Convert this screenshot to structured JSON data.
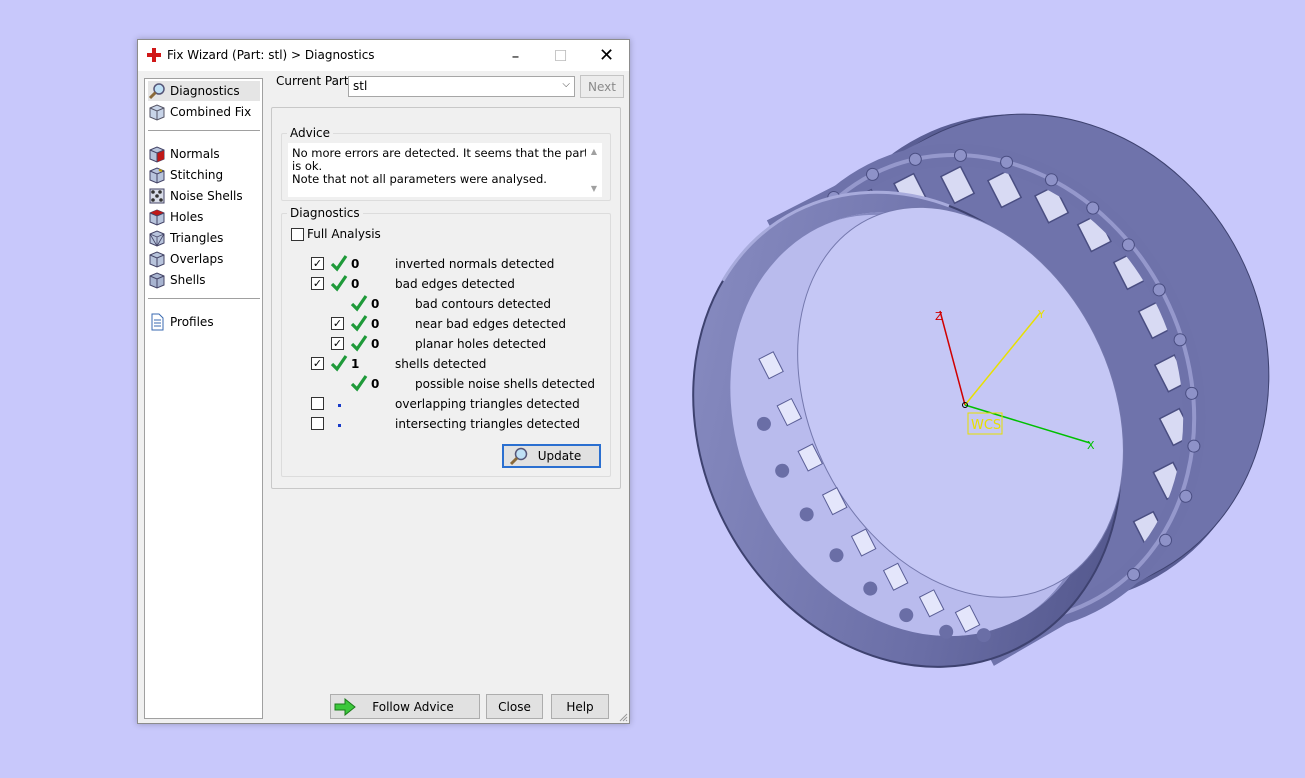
{
  "window": {
    "title": "Fix Wizard (Part: stl) > Diagnostics",
    "minimize": "–",
    "maximize": "☐",
    "close": "✕"
  },
  "sidebar": {
    "items": [
      {
        "label": "Diagnostics",
        "icon": "magnifier-icon",
        "selected": true
      },
      {
        "label": "Combined Fix",
        "icon": "cube-icon"
      },
      {
        "label": "Normals",
        "icon": "normals-cube-icon"
      },
      {
        "label": "Stitching",
        "icon": "stitching-cube-icon"
      },
      {
        "label": "Noise Shells",
        "icon": "noise-shells-icon"
      },
      {
        "label": "Holes",
        "icon": "holes-cube-icon"
      },
      {
        "label": "Triangles",
        "icon": "triangles-cube-icon"
      },
      {
        "label": "Overlaps",
        "icon": "overlaps-cube-icon"
      },
      {
        "label": "Shells",
        "icon": "shells-cube-icon"
      },
      {
        "label": "Profiles",
        "icon": "document-icon"
      }
    ]
  },
  "main": {
    "current_part_label": "Current Part:",
    "current_part_value": "stl",
    "next_label": "Next",
    "advice": {
      "title": "Advice",
      "text_line1": "No more errors are detected. It seems that the part is ok.",
      "text_line2": "Note that not all parameters were analysed."
    },
    "diagnostics": {
      "title": "Diagnostics",
      "full_analysis_label": "Full Analysis",
      "full_analysis_checked": false,
      "rows": [
        {
          "checked": true,
          "status": "ok",
          "count": "0",
          "label": "inverted normals detected"
        },
        {
          "checked": true,
          "status": "ok",
          "count": "0",
          "label": "bad edges detected"
        },
        {
          "checkbox": false,
          "status": "ok",
          "count": "0",
          "label": "bad contours detected"
        },
        {
          "checked": true,
          "status": "ok",
          "count": "0",
          "label": "near bad edges detected"
        },
        {
          "checked": true,
          "status": "ok",
          "count": "0",
          "label": "planar holes detected"
        },
        {
          "checked": true,
          "status": "ok",
          "count": "1",
          "label": "shells detected"
        },
        {
          "checkbox": false,
          "status": "ok",
          "count": "0",
          "label": "possible noise shells detected"
        },
        {
          "checked": false,
          "status": "not-run",
          "count": "",
          "label": "overlapping triangles detected"
        },
        {
          "checked": false,
          "status": "not-run",
          "count": "",
          "label": "intersecting triangles detected"
        }
      ],
      "update_label": "Update"
    },
    "footer": {
      "follow_advice_label": "Follow Advice",
      "close_label": "Close",
      "help_label": "Help"
    }
  },
  "viewport": {
    "axis_x": "X",
    "axis_y": "Y",
    "axis_z": "Z",
    "wcs_label": "WCS",
    "colors": {
      "background": "#c8c8fb",
      "model": "#7478ad",
      "axis_x": "#00c000",
      "axis_y": "#e8e000",
      "axis_z": "#d00000",
      "tick_green": "#1f9a3a"
    }
  }
}
